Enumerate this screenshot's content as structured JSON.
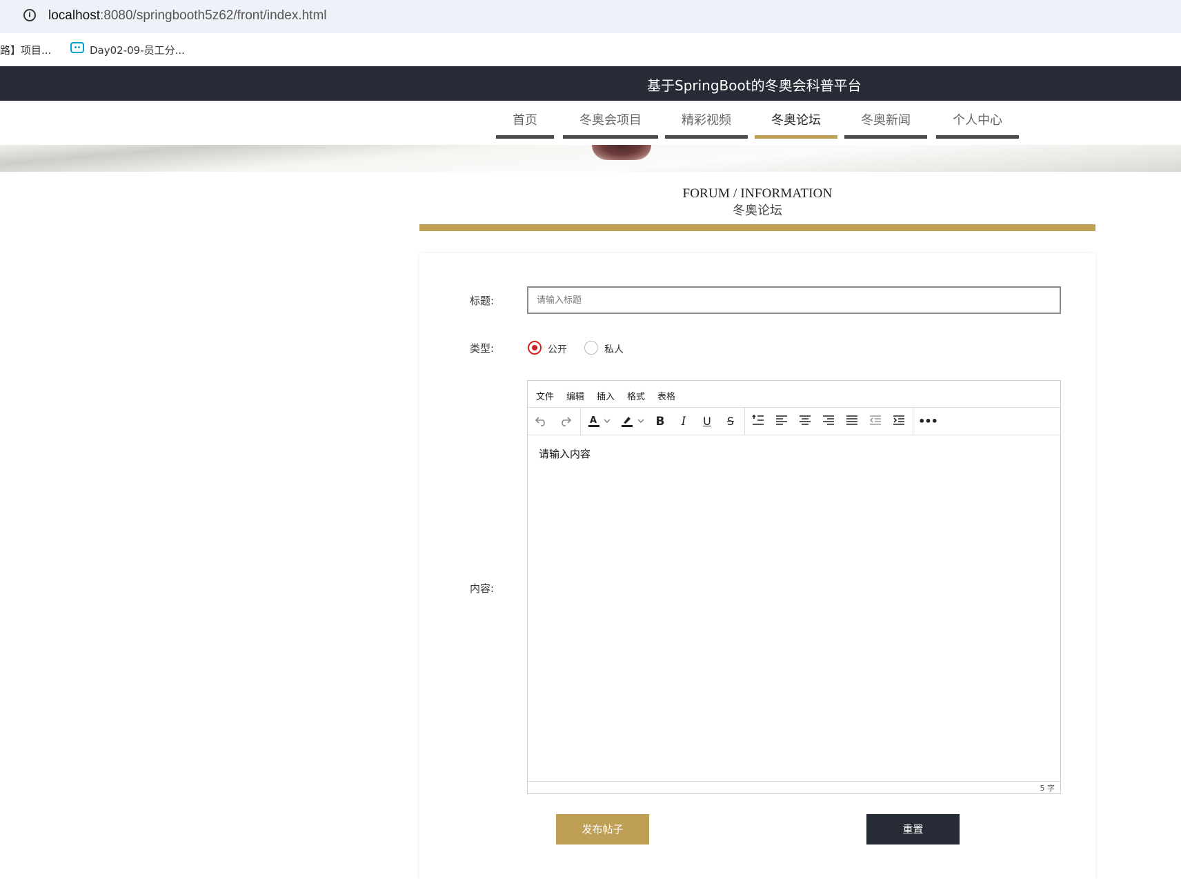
{
  "browser": {
    "url_host": "localhost",
    "url_rest": ":8080/springbooth5z62/front/index.html",
    "bookmarks": [
      "路】项目...",
      "Day02-09-员工分..."
    ]
  },
  "site": {
    "title": "基于SpringBoot的冬奥会科普平台"
  },
  "nav": {
    "items": [
      {
        "label": "首页",
        "active": false
      },
      {
        "label": "冬奥会项目",
        "active": false
      },
      {
        "label": "精彩视频",
        "active": false
      },
      {
        "label": "冬奥论坛",
        "active": true
      },
      {
        "label": "冬奥新闻",
        "active": false
      },
      {
        "label": "个人中心",
        "active": false
      }
    ]
  },
  "section": {
    "title_en": "FORUM / INFORMATION",
    "title_cn": "冬奥论坛"
  },
  "form": {
    "title_label": "标题:",
    "title_placeholder": "请输入标题",
    "type_label": "类型:",
    "type_options": [
      {
        "label": "公开",
        "selected": true
      },
      {
        "label": "私人",
        "selected": false
      }
    ],
    "content_label": "内容:",
    "submit_label": "发布帖子",
    "reset_label": "重置"
  },
  "editor": {
    "menu": [
      "文件",
      "编辑",
      "插入",
      "格式",
      "表格"
    ],
    "toolbar_icons": [
      "undo-icon",
      "redo-icon",
      "text-color-icon",
      "highlight-color-icon",
      "bold-icon",
      "italic-icon",
      "underline-icon",
      "strikethrough-icon",
      "line-height-icon",
      "align-left-icon",
      "align-center-icon",
      "align-right-icon",
      "align-justify-icon",
      "outdent-icon",
      "indent-icon",
      "more-icon"
    ],
    "content": "请输入内容",
    "word_count": "5 字"
  },
  "colors": {
    "accent_gold": "#bf9f55",
    "dark": "#262b35",
    "radio_red": "#d02020"
  }
}
